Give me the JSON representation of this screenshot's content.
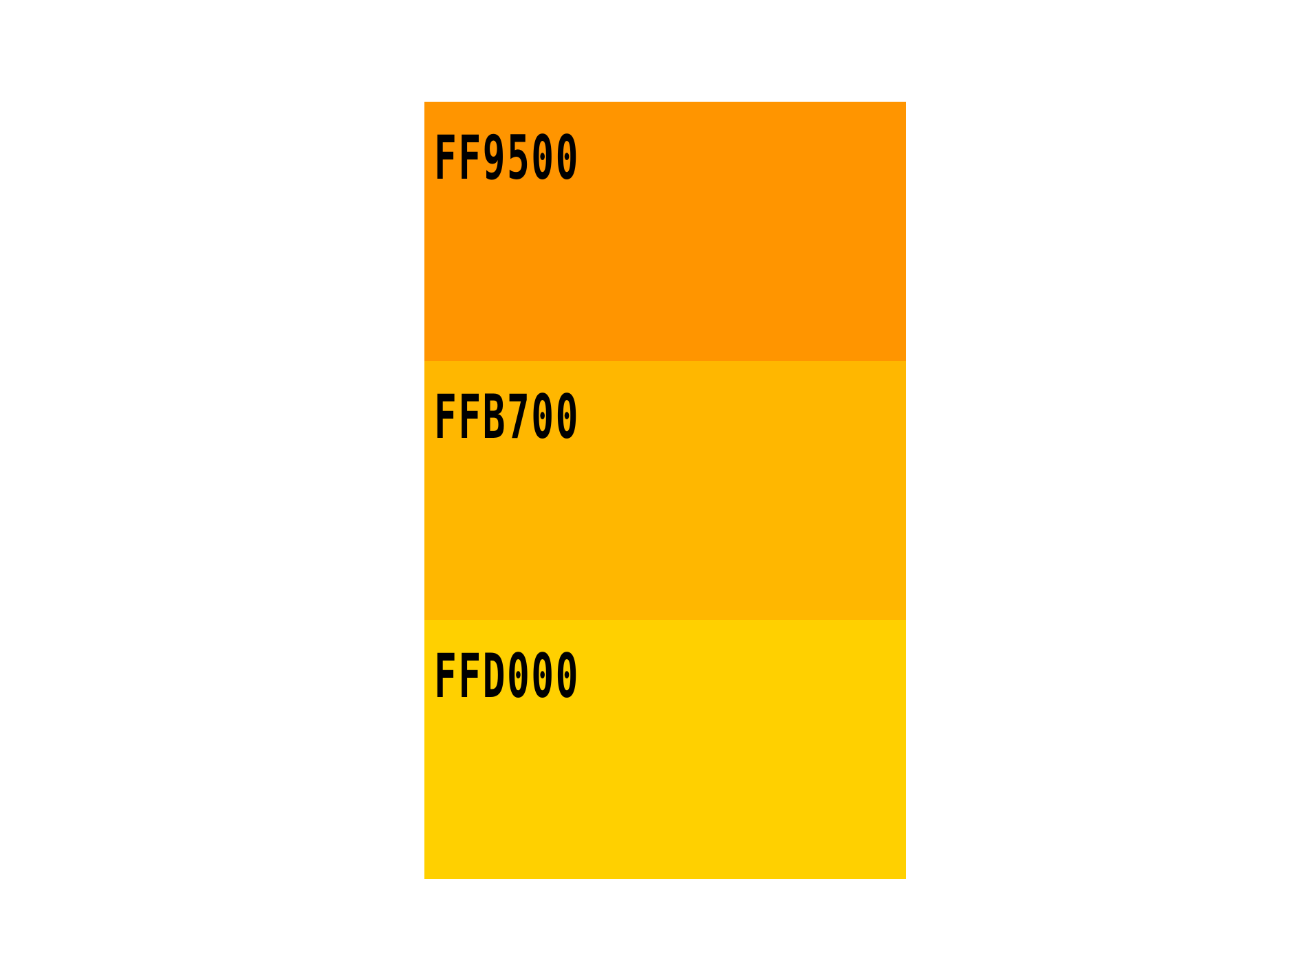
{
  "swatches": [
    {
      "label": "FF9500",
      "color": "#FF9500"
    },
    {
      "label": "FFB700",
      "color": "#FFB700"
    },
    {
      "label": "FFD000",
      "color": "#FFD000"
    }
  ]
}
